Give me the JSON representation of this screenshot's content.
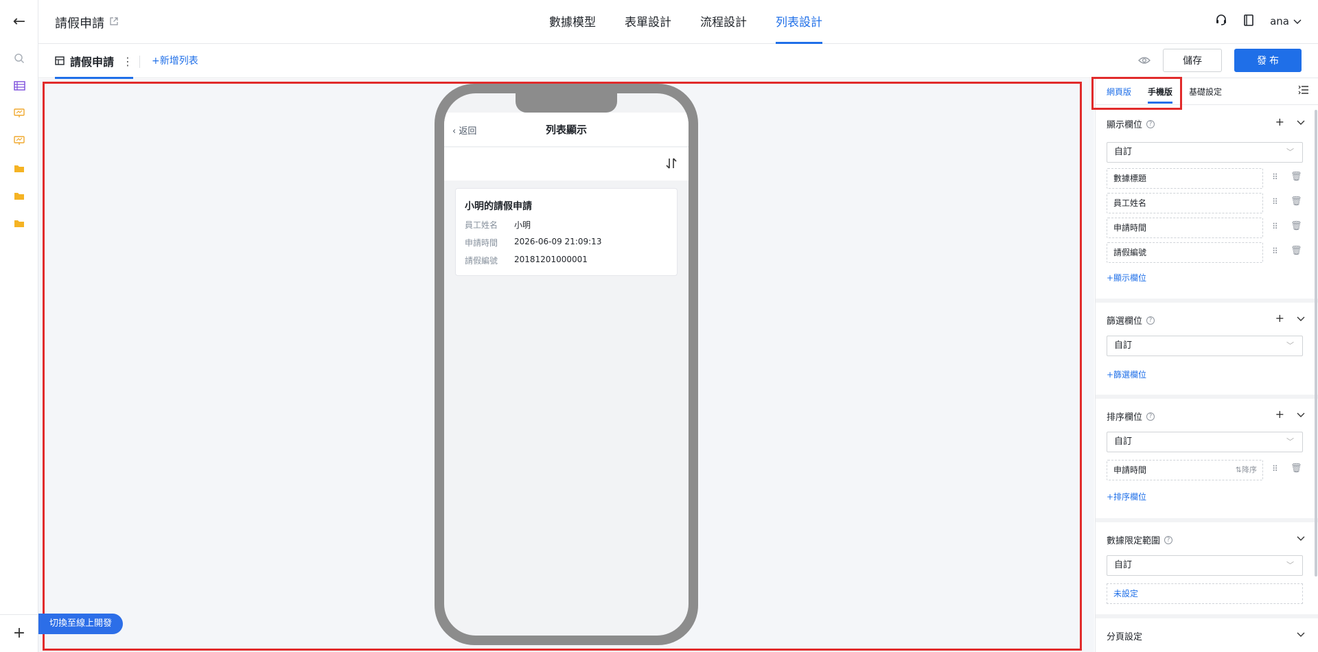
{
  "app": {
    "title": "請假申請",
    "user": "ana"
  },
  "main_tabs": [
    "數據模型",
    "表單設計",
    "流程設計",
    "列表設計"
  ],
  "active_main_tab": "列表設計",
  "subbar": {
    "list_tab": "請假申請",
    "add_list": "+新增列表",
    "save": "儲存",
    "publish": "發 布"
  },
  "phone": {
    "back": "返回",
    "title": "列表顯示",
    "card": {
      "title": "小明的請假申請",
      "rows": [
        {
          "k": "員工姓名",
          "v": "小明"
        },
        {
          "k": "申請時間",
          "v": "2026-06-09 21:09:13"
        },
        {
          "k": "請假編號",
          "v": "20181201000001"
        }
      ]
    }
  },
  "switch_button": "切換至線上開發",
  "panel": {
    "tabs": {
      "web": "網頁版",
      "mobile": "手機版",
      "basic": "基礎設定"
    },
    "display": {
      "title": "顯示欄位",
      "select": "自訂",
      "fields": [
        "數據標題",
        "員工姓名",
        "申請時間",
        "請假編號"
      ],
      "add": "+顯示欄位"
    },
    "filter": {
      "title": "篩選欄位",
      "select": "自訂",
      "add": "+篩選欄位"
    },
    "sort": {
      "title": "排序欄位",
      "select": "自訂",
      "field": "申請時間",
      "order": "降序",
      "add": "+排序欄位"
    },
    "scope": {
      "title": "數據限定範圍",
      "select": "自訂",
      "unset": "未設定"
    },
    "paging": {
      "title": "分頁設定"
    }
  },
  "colors": {
    "accent": "#1f6fe8",
    "highlight": "#e12b2b"
  }
}
